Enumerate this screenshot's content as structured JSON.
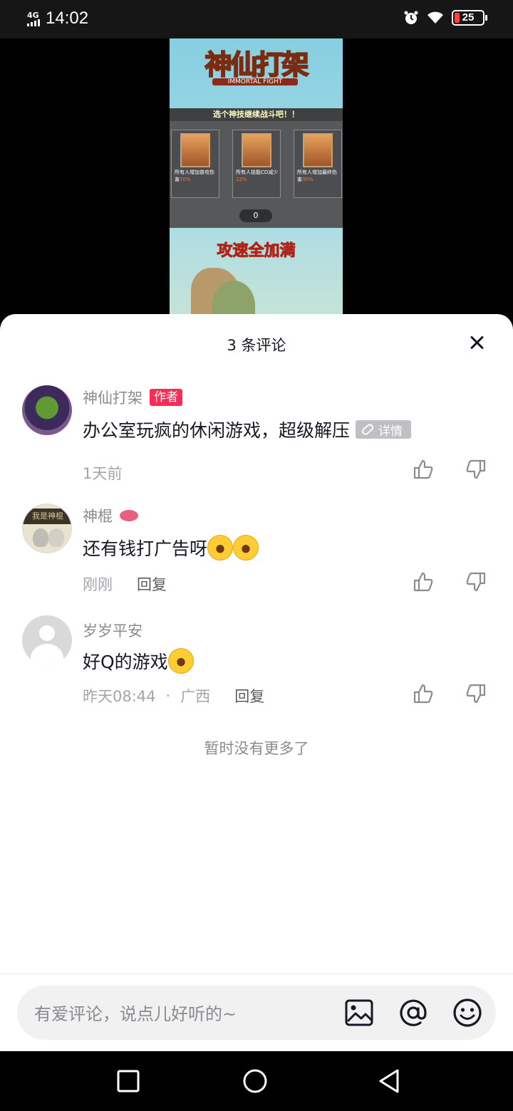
{
  "status_bar": {
    "network": "4G",
    "time": "14:02",
    "battery": "25"
  },
  "video": {
    "game_title": "神仙打架",
    "game_subtitle": "IMMORTAL FIGHT",
    "skill_banner": "选个神技继续战斗吧！！",
    "cards": [
      {
        "desc": "所有人增加普攻伤害",
        "value": "70%"
      },
      {
        "desc": "所有人技能CD减少",
        "value": "22%"
      },
      {
        "desc": "所有人增加最终伤害",
        "value": "30%"
      }
    ],
    "counter": "0",
    "slogan": "攻速全加满"
  },
  "comments_panel": {
    "title": "3 条评论",
    "comments": [
      {
        "name": "神仙打架",
        "badge": "作者",
        "text": "办公室玩疯的休闲游戏，超级解压",
        "detail_tag": "详情",
        "time": "1天前"
      },
      {
        "name": "神棍",
        "text": "还有钱打广告呀",
        "time": "刚刚",
        "reply": "回复",
        "avatar_text": "我是神棍"
      },
      {
        "name": "岁岁平安",
        "text": "好Q的游戏",
        "time": "昨天08:44",
        "separator": "·",
        "location": "广西",
        "reply": "回复"
      }
    ],
    "no_more": "暂时没有更多了"
  },
  "input_bar": {
    "placeholder": "有爱评论，说点儿好听的~",
    "icons": [
      "image-icon",
      "at-icon",
      "emoji-icon"
    ]
  },
  "nav_bar": {
    "icons": [
      "recent-apps-icon",
      "home-icon",
      "back-icon"
    ]
  },
  "colors": {
    "accent": "#fe2c55",
    "text": "#161823",
    "secondary": "#8a8b91"
  }
}
